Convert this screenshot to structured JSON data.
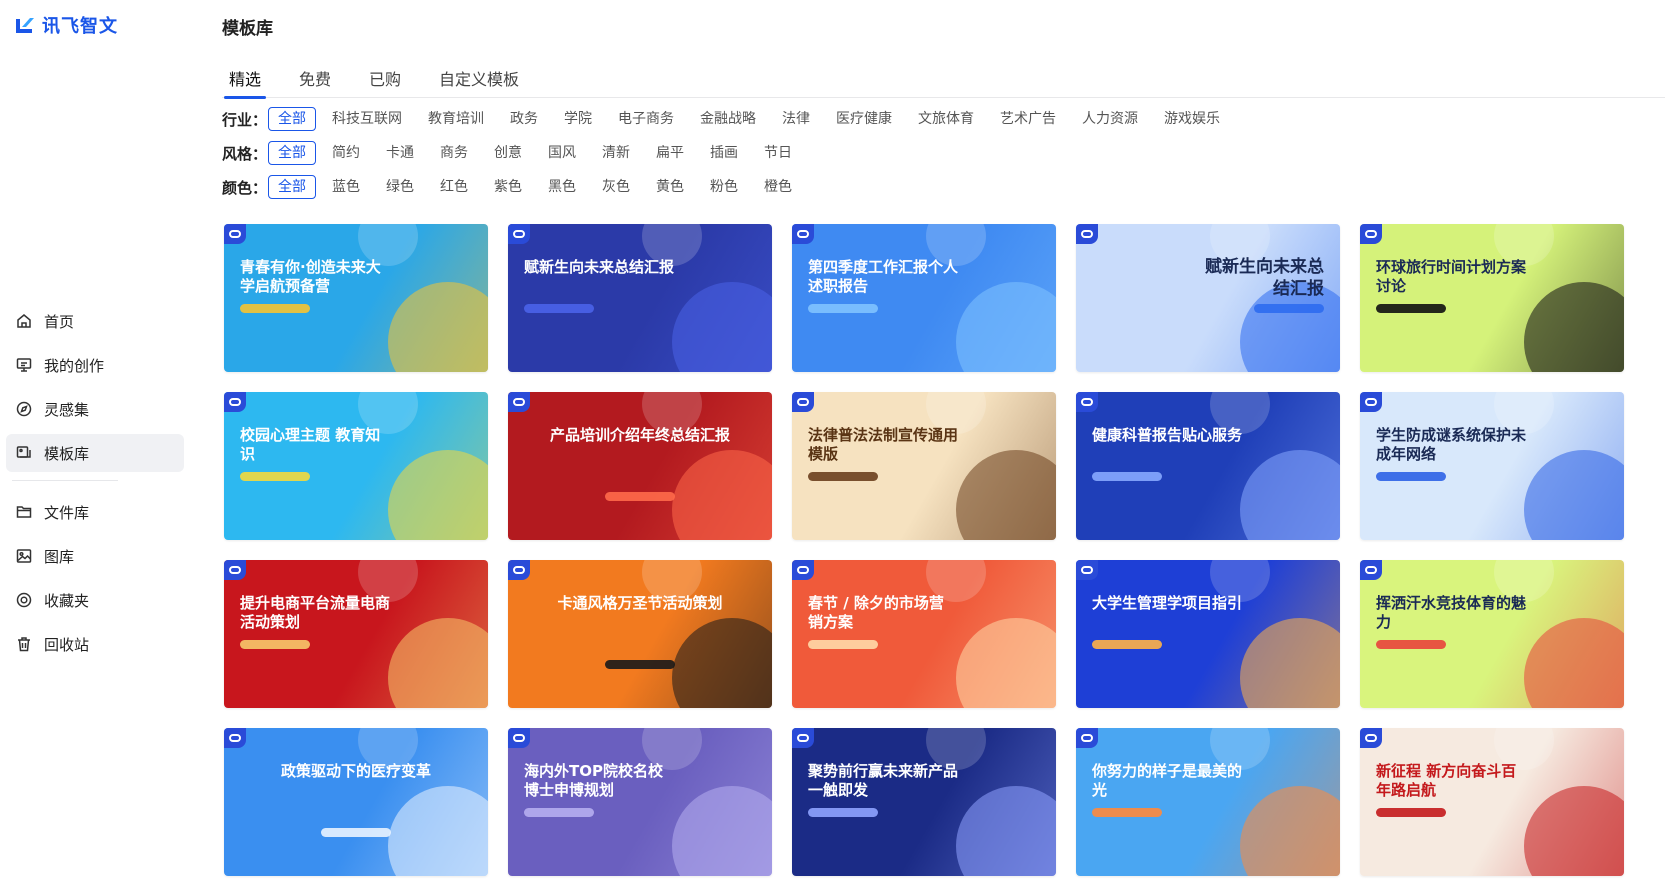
{
  "app": {
    "logo_text": "讯飞智文"
  },
  "sidebar": {
    "items": [
      {
        "label": "首页",
        "icon": "home-icon"
      },
      {
        "label": "我的创作",
        "icon": "presentation-icon"
      },
      {
        "label": "灵感集",
        "icon": "compass-icon"
      },
      {
        "label": "模板库",
        "icon": "template-icon"
      }
    ],
    "items2": [
      {
        "label": "文件库",
        "icon": "folder-icon"
      },
      {
        "label": "图库",
        "icon": "image-icon"
      },
      {
        "label": "收藏夹",
        "icon": "bookmark-icon"
      },
      {
        "label": "回收站",
        "icon": "trash-icon"
      }
    ]
  },
  "page": {
    "title": "模板库"
  },
  "tabs": [
    "精选",
    "免费",
    "已购",
    "自定义模板"
  ],
  "filters": {
    "industry": {
      "label": "行业：",
      "options": [
        "全部",
        "科技互联网",
        "教育培训",
        "政务",
        "学院",
        "电子商务",
        "金融战略",
        "法律",
        "医疗健康",
        "文旅体育",
        "艺术广告",
        "人力资源",
        "游戏娱乐"
      ]
    },
    "style": {
      "label": "风格：",
      "options": [
        "全部",
        "简约",
        "卡通",
        "商务",
        "创意",
        "国风",
        "清新",
        "扁平",
        "插画",
        "节日"
      ]
    },
    "color": {
      "label": "颜色：",
      "options": [
        "全部",
        "蓝色",
        "绿色",
        "红色",
        "紫色",
        "黑色",
        "灰色",
        "黄色",
        "粉色",
        "橙色"
      ]
    }
  },
  "templates": [
    {
      "title": "青春有你·创造未来大学启航预备营",
      "bg": "#2aa7e8",
      "accent": "#f6c431",
      "layout": "left"
    },
    {
      "title": "赋新生向未来总结汇报",
      "bg": "#2b3aa8",
      "accent": "#4a63e8",
      "layout": "left"
    },
    {
      "title": "第四季度工作汇报个人述职报告",
      "bg": "#3f8af2",
      "accent": "#7fc2ff",
      "layout": "left"
    },
    {
      "title": "赋新生向未来总结汇报",
      "bg": "#c9dcfb",
      "accent": "#2d6cf0",
      "layout": "right"
    },
    {
      "title": "环球旅行时间计划方案讨论",
      "bg": "#d5f27a",
      "accent": "#111111",
      "layout": "left"
    },
    {
      "title": "校园心理主题 教育知识",
      "bg": "#2db8f0",
      "accent": "#f4d93c",
      "layout": "left"
    },
    {
      "title": "产品培训介绍年终总结汇报",
      "bg": "#b31a1f",
      "accent": "#ff6a4a",
      "layout": "center"
    },
    {
      "title": "法律普法法制宣传通用模版",
      "bg": "#f6e2c0",
      "accent": "#6b3f1d",
      "layout": "left"
    },
    {
      "title": "健康科普报告贴心服务",
      "bg": "#1f3fb8",
      "accent": "#86a8ff",
      "layout": "left"
    },
    {
      "title": "学生防成谜系统保护未成年网络",
      "bg": "#d8e8fb",
      "accent": "#2e62e6",
      "layout": "left"
    },
    {
      "title": "提升电商平台流量电商活动策划",
      "bg": "#c8161d",
      "accent": "#f7c86b",
      "layout": "left"
    },
    {
      "title": "卡通风格万圣节活动策划",
      "bg": "#f27a1f",
      "accent": "#1a1a1a",
      "layout": "center"
    },
    {
      "title": "春节 / 除夕的市场营销方案",
      "bg": "#f05a3a",
      "accent": "#ffd9a8",
      "layout": "left"
    },
    {
      "title": "大学生管理学项目指引",
      "bg": "#1e3fd6",
      "accent": "#ffb347",
      "layout": "left"
    },
    {
      "title": "挥洒汗水竞技体育的魅力",
      "bg": "#d9f47d",
      "accent": "#e8433c",
      "layout": "left"
    },
    {
      "title": "政策驱动下的医疗变革",
      "bg": "#3a8ff0",
      "accent": "#e9f3ff",
      "layout": "center"
    },
    {
      "title": "海内外TOP院校名校博士申博规划",
      "bg": "#6a5fbf",
      "accent": "#b6aef0",
      "layout": "left"
    },
    {
      "title": "聚势前行赢未来新产品一触即发",
      "bg": "#1b2b86",
      "accent": "#8fa3ff",
      "layout": "left"
    },
    {
      "title": "你努力的样子是最美的光",
      "bg": "#4aa6f2",
      "accent": "#ff8a3c",
      "layout": "left"
    },
    {
      "title": "新征程 新方向奋斗百年路启航",
      "bg": "#f6eae0",
      "accent": "#c4191c",
      "layout": "left"
    }
  ]
}
